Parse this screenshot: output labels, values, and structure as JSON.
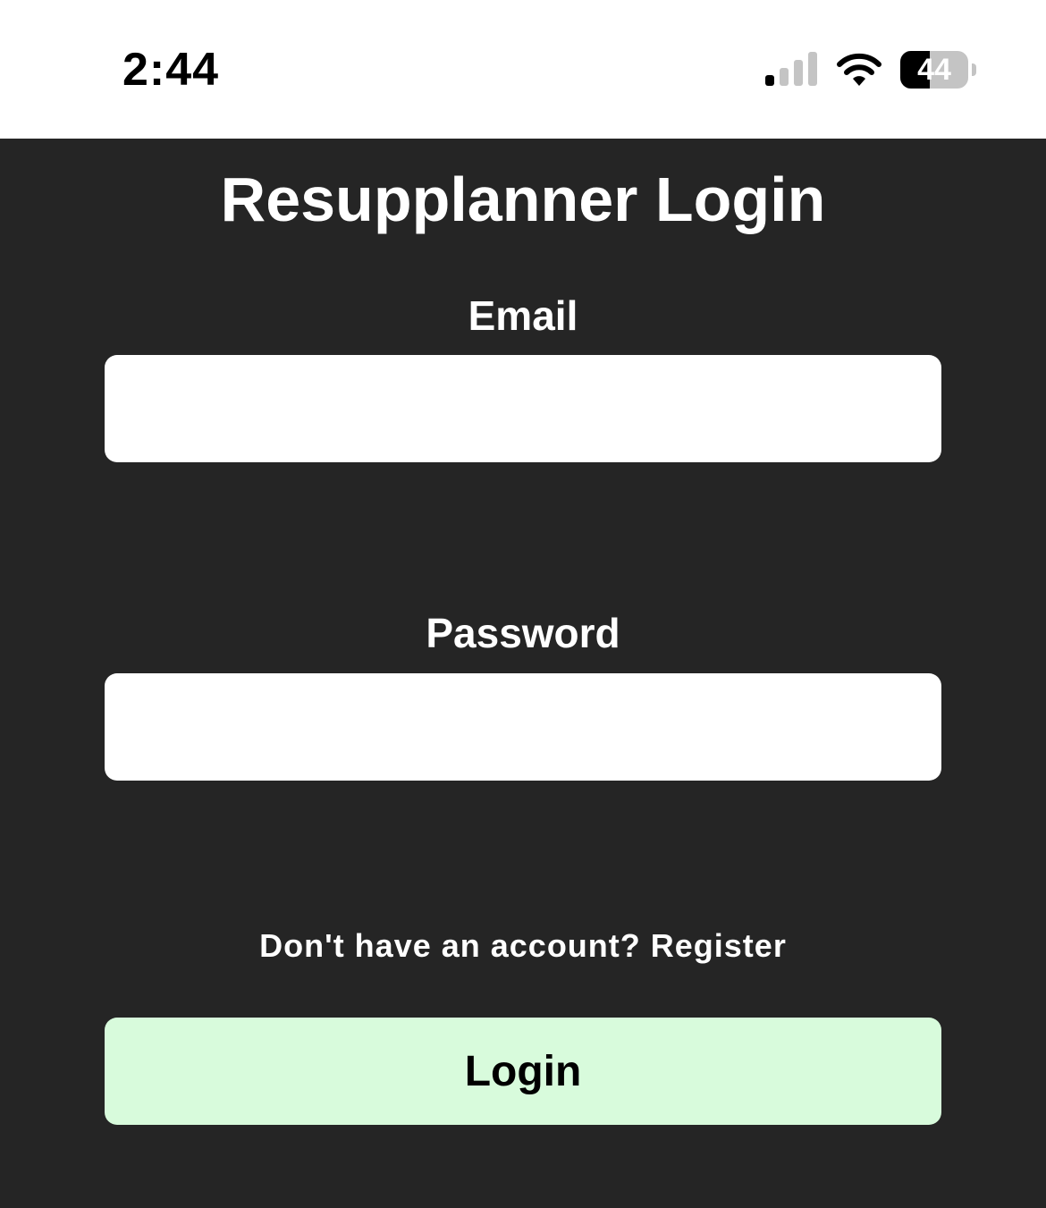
{
  "status_bar": {
    "time": "2:44",
    "battery_level": "44",
    "battery_fraction": 0.44,
    "signal_bars_active": 1,
    "signal_bars_total": 4
  },
  "login": {
    "title": "Resupplanner Login",
    "email_label": "Email",
    "email_value": "",
    "password_label": "Password",
    "password_value": "",
    "register_prompt": "Don't have an account? Register",
    "login_button": "Login"
  },
  "colors": {
    "background": "#252525",
    "button_bg": "#d8fbdc",
    "input_bg": "#ffffff",
    "status_bar_bg": "#ffffff"
  }
}
